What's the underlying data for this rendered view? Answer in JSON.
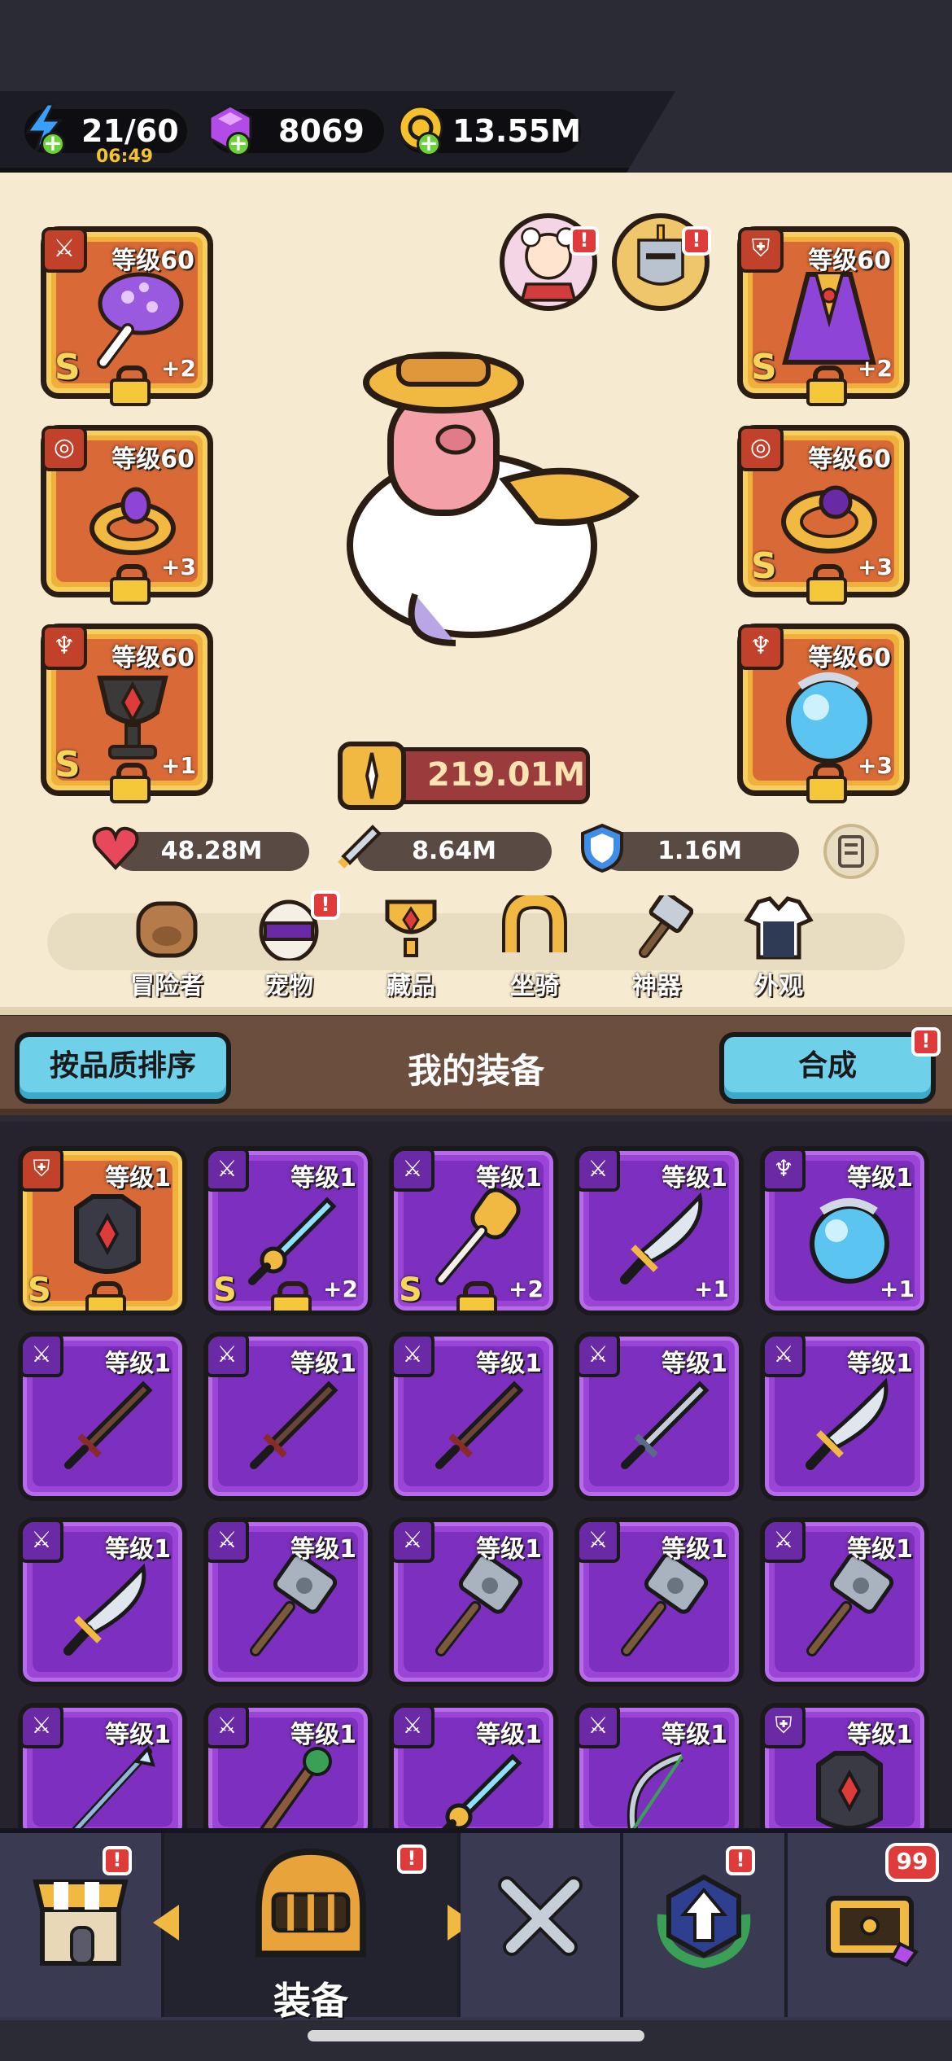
{
  "resources": {
    "energy": "21/60",
    "energy_timer": "06:49",
    "gems": "8069",
    "coins": "13.55M"
  },
  "equipped": {
    "left": [
      {
        "level": "等级60",
        "rank": "S",
        "plus": "+2",
        "icon": "mushroom-staff-icon"
      },
      {
        "level": "等级60",
        "rank": "",
        "plus": "+3",
        "icon": "ring-icon"
      },
      {
        "level": "等级60",
        "rank": "S",
        "plus": "+1",
        "icon": "chalice-icon"
      }
    ],
    "right": [
      {
        "level": "等级60",
        "rank": "S",
        "plus": "+2",
        "icon": "robe-icon"
      },
      {
        "level": "等级60",
        "rank": "S",
        "plus": "+3",
        "icon": "bracelet-icon"
      },
      {
        "level": "等级60",
        "rank": "",
        "plus": "+3",
        "icon": "orb-icon"
      }
    ]
  },
  "power": "219.01M",
  "stats": {
    "hp": "48.28M",
    "attack": "8.64M",
    "defense": "1.16M"
  },
  "nav": [
    "冒险者",
    "宠物",
    "藏品",
    "坐骑",
    "神器",
    "外观"
  ],
  "list_header": {
    "sort_button": "按品质排序",
    "title": "我的装备",
    "merge_button": "合成",
    "badge": "!"
  },
  "inventory": [
    {
      "level": "等级1",
      "rank": "S",
      "plus": "",
      "quality": "gold",
      "icon": "armor-icon"
    },
    {
      "level": "等级1",
      "rank": "S",
      "plus": "+2",
      "quality": "purple",
      "icon": "ice-sword-icon"
    },
    {
      "level": "等级1",
      "rank": "S",
      "plus": "+2",
      "quality": "purple",
      "icon": "mace-icon"
    },
    {
      "level": "等级1",
      "rank": "",
      "plus": "+1",
      "quality": "purple",
      "icon": "blade-icon"
    },
    {
      "level": "等级1",
      "rank": "",
      "plus": "+1",
      "quality": "purple",
      "icon": "orb-icon"
    },
    {
      "level": "等级1",
      "rank": "",
      "plus": "",
      "quality": "purple",
      "icon": "wood-sword-icon"
    },
    {
      "level": "等级1",
      "rank": "",
      "plus": "",
      "quality": "purple",
      "icon": "wood-sword-icon"
    },
    {
      "level": "等级1",
      "rank": "",
      "plus": "",
      "quality": "purple",
      "icon": "wood-sword-icon"
    },
    {
      "level": "等级1",
      "rank": "",
      "plus": "",
      "quality": "purple",
      "icon": "steel-sword-icon"
    },
    {
      "level": "等级1",
      "rank": "",
      "plus": "",
      "quality": "purple",
      "icon": "blade-icon"
    },
    {
      "level": "等级1",
      "rank": "",
      "plus": "",
      "quality": "purple",
      "icon": "blade-icon"
    },
    {
      "level": "等级1",
      "rank": "",
      "plus": "",
      "quality": "purple",
      "icon": "hammer-icon"
    },
    {
      "level": "等级1",
      "rank": "",
      "plus": "",
      "quality": "purple",
      "icon": "hammer-icon"
    },
    {
      "level": "等级1",
      "rank": "",
      "plus": "",
      "quality": "purple",
      "icon": "hammer-icon"
    },
    {
      "level": "等级1",
      "rank": "",
      "plus": "",
      "quality": "purple",
      "icon": "hammer-icon"
    },
    {
      "level": "等级1",
      "rank": "",
      "plus": "",
      "quality": "purple",
      "icon": "spear-icon"
    },
    {
      "level": "等级1",
      "rank": "",
      "plus": "",
      "quality": "purple",
      "icon": "wood-staff-icon"
    },
    {
      "level": "等级1",
      "rank": "",
      "plus": "",
      "quality": "purple",
      "icon": "ice-sword-icon"
    },
    {
      "level": "等级1",
      "rank": "",
      "plus": "",
      "quality": "purple",
      "icon": "bow-icon"
    },
    {
      "level": "等级1",
      "rank": "",
      "plus": "",
      "quality": "purple",
      "icon": "armor-icon"
    }
  ],
  "tabs": {
    "active_label": "装备",
    "chest_badge": "99",
    "alert": "!"
  },
  "colors": {
    "purple_card": "#9a45d6",
    "gold_card": "#f0b13c",
    "accent_blue": "#6fd0ea",
    "alert_red": "#e03b3b"
  }
}
